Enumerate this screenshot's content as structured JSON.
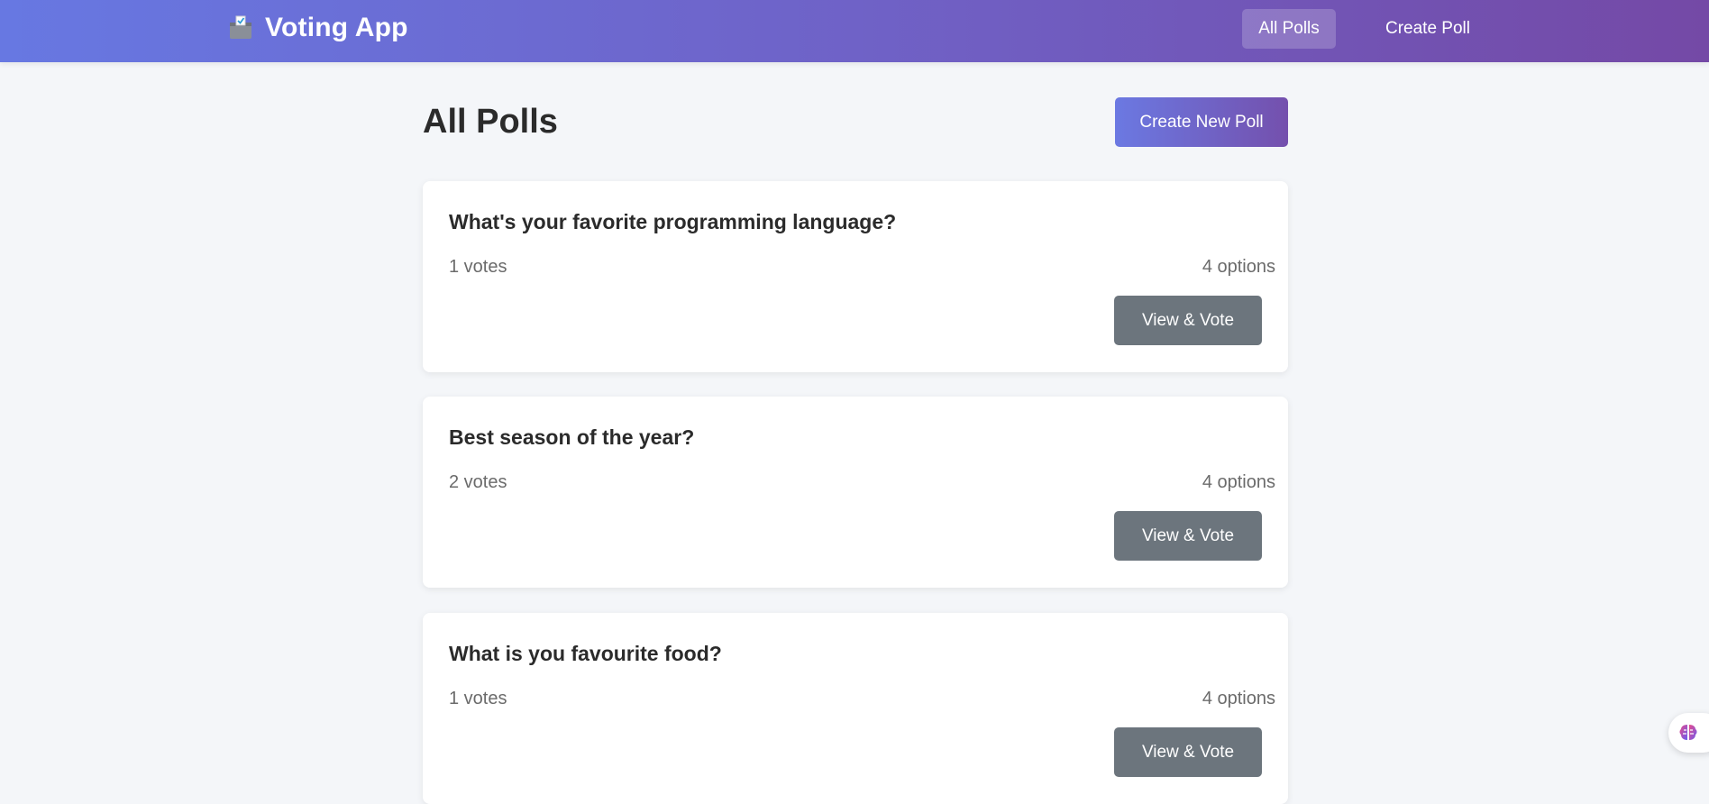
{
  "header": {
    "brand_title": "Voting App",
    "brand_icon": "ballot-box-icon",
    "nav": [
      {
        "label": "All Polls",
        "active": true
      },
      {
        "label": "Create Poll",
        "active": false
      }
    ]
  },
  "main": {
    "title": "All Polls",
    "create_button_label": "Create New Poll",
    "polls": [
      {
        "question": "What's your favorite programming language?",
        "votes_text": "1 votes",
        "options_text": "4 options",
        "button_label": "View & Vote"
      },
      {
        "question": "Best season of the year?",
        "votes_text": "2 votes",
        "options_text": "4 options",
        "button_label": "View & Vote"
      },
      {
        "question": "What is you favourite food?",
        "votes_text": "1 votes",
        "options_text": "4 options",
        "button_label": "View & Vote"
      }
    ]
  },
  "widget": {
    "icon": "brain-icon"
  },
  "colors": {
    "header_gradient_start": "#6778e2",
    "header_gradient_end": "#7449a6",
    "primary_button": "#6b79e2",
    "secondary_button": "#6c757d",
    "background": "#f4f6f9"
  }
}
